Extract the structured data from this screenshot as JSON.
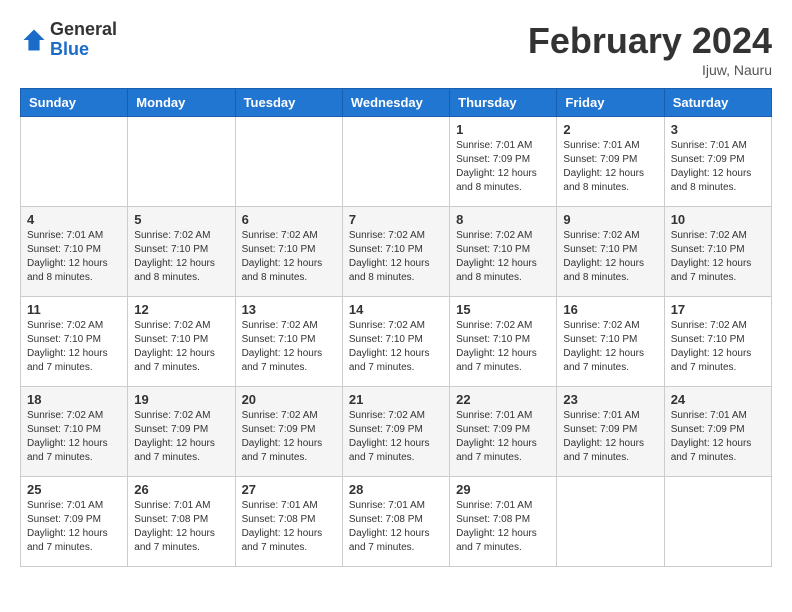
{
  "header": {
    "logo_general": "General",
    "logo_blue": "Blue",
    "month_title": "February 2024",
    "location": "Ijuw, Nauru"
  },
  "weekdays": [
    "Sunday",
    "Monday",
    "Tuesday",
    "Wednesday",
    "Thursday",
    "Friday",
    "Saturday"
  ],
  "weeks": [
    [
      {
        "day": "",
        "info": ""
      },
      {
        "day": "",
        "info": ""
      },
      {
        "day": "",
        "info": ""
      },
      {
        "day": "",
        "info": ""
      },
      {
        "day": "1",
        "info": "Sunrise: 7:01 AM\nSunset: 7:09 PM\nDaylight: 12 hours\nand 8 minutes."
      },
      {
        "day": "2",
        "info": "Sunrise: 7:01 AM\nSunset: 7:09 PM\nDaylight: 12 hours\nand 8 minutes."
      },
      {
        "day": "3",
        "info": "Sunrise: 7:01 AM\nSunset: 7:09 PM\nDaylight: 12 hours\nand 8 minutes."
      }
    ],
    [
      {
        "day": "4",
        "info": "Sunrise: 7:01 AM\nSunset: 7:10 PM\nDaylight: 12 hours\nand 8 minutes."
      },
      {
        "day": "5",
        "info": "Sunrise: 7:02 AM\nSunset: 7:10 PM\nDaylight: 12 hours\nand 8 minutes."
      },
      {
        "day": "6",
        "info": "Sunrise: 7:02 AM\nSunset: 7:10 PM\nDaylight: 12 hours\nand 8 minutes."
      },
      {
        "day": "7",
        "info": "Sunrise: 7:02 AM\nSunset: 7:10 PM\nDaylight: 12 hours\nand 8 minutes."
      },
      {
        "day": "8",
        "info": "Sunrise: 7:02 AM\nSunset: 7:10 PM\nDaylight: 12 hours\nand 8 minutes."
      },
      {
        "day": "9",
        "info": "Sunrise: 7:02 AM\nSunset: 7:10 PM\nDaylight: 12 hours\nand 8 minutes."
      },
      {
        "day": "10",
        "info": "Sunrise: 7:02 AM\nSunset: 7:10 PM\nDaylight: 12 hours\nand 7 minutes."
      }
    ],
    [
      {
        "day": "11",
        "info": "Sunrise: 7:02 AM\nSunset: 7:10 PM\nDaylight: 12 hours\nand 7 minutes."
      },
      {
        "day": "12",
        "info": "Sunrise: 7:02 AM\nSunset: 7:10 PM\nDaylight: 12 hours\nand 7 minutes."
      },
      {
        "day": "13",
        "info": "Sunrise: 7:02 AM\nSunset: 7:10 PM\nDaylight: 12 hours\nand 7 minutes."
      },
      {
        "day": "14",
        "info": "Sunrise: 7:02 AM\nSunset: 7:10 PM\nDaylight: 12 hours\nand 7 minutes."
      },
      {
        "day": "15",
        "info": "Sunrise: 7:02 AM\nSunset: 7:10 PM\nDaylight: 12 hours\nand 7 minutes."
      },
      {
        "day": "16",
        "info": "Sunrise: 7:02 AM\nSunset: 7:10 PM\nDaylight: 12 hours\nand 7 minutes."
      },
      {
        "day": "17",
        "info": "Sunrise: 7:02 AM\nSunset: 7:10 PM\nDaylight: 12 hours\nand 7 minutes."
      }
    ],
    [
      {
        "day": "18",
        "info": "Sunrise: 7:02 AM\nSunset: 7:10 PM\nDaylight: 12 hours\nand 7 minutes."
      },
      {
        "day": "19",
        "info": "Sunrise: 7:02 AM\nSunset: 7:09 PM\nDaylight: 12 hours\nand 7 minutes."
      },
      {
        "day": "20",
        "info": "Sunrise: 7:02 AM\nSunset: 7:09 PM\nDaylight: 12 hours\nand 7 minutes."
      },
      {
        "day": "21",
        "info": "Sunrise: 7:02 AM\nSunset: 7:09 PM\nDaylight: 12 hours\nand 7 minutes."
      },
      {
        "day": "22",
        "info": "Sunrise: 7:01 AM\nSunset: 7:09 PM\nDaylight: 12 hours\nand 7 minutes."
      },
      {
        "day": "23",
        "info": "Sunrise: 7:01 AM\nSunset: 7:09 PM\nDaylight: 12 hours\nand 7 minutes."
      },
      {
        "day": "24",
        "info": "Sunrise: 7:01 AM\nSunset: 7:09 PM\nDaylight: 12 hours\nand 7 minutes."
      }
    ],
    [
      {
        "day": "25",
        "info": "Sunrise: 7:01 AM\nSunset: 7:09 PM\nDaylight: 12 hours\nand 7 minutes."
      },
      {
        "day": "26",
        "info": "Sunrise: 7:01 AM\nSunset: 7:08 PM\nDaylight: 12 hours\nand 7 minutes."
      },
      {
        "day": "27",
        "info": "Sunrise: 7:01 AM\nSunset: 7:08 PM\nDaylight: 12 hours\nand 7 minutes."
      },
      {
        "day": "28",
        "info": "Sunrise: 7:01 AM\nSunset: 7:08 PM\nDaylight: 12 hours\nand 7 minutes."
      },
      {
        "day": "29",
        "info": "Sunrise: 7:01 AM\nSunset: 7:08 PM\nDaylight: 12 hours\nand 7 minutes."
      },
      {
        "day": "",
        "info": ""
      },
      {
        "day": "",
        "info": ""
      }
    ]
  ]
}
